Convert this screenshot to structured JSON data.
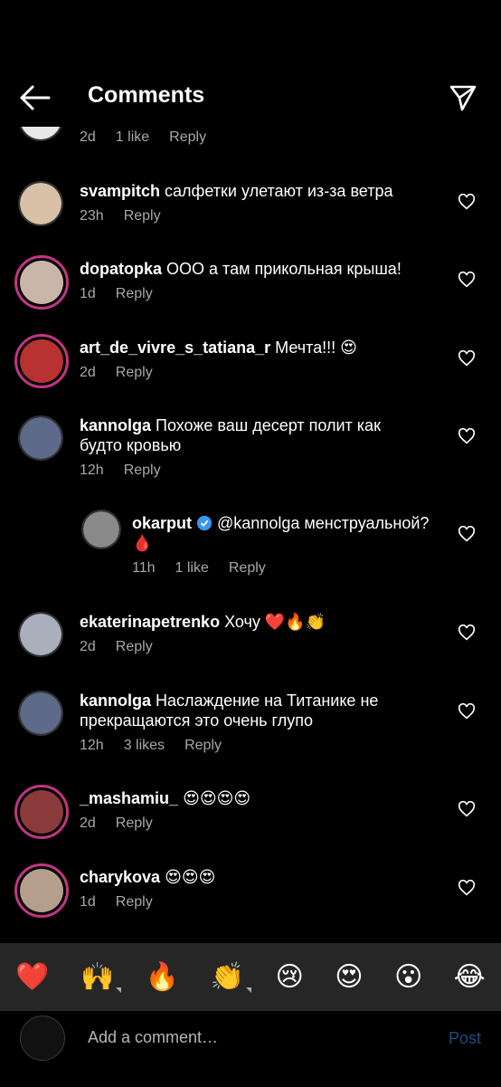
{
  "header": {
    "title": "Comments",
    "back_icon": "back-arrow-icon",
    "send_icon": "send-icon"
  },
  "comments": [
    {
      "user": "",
      "text": "",
      "time": "2d",
      "likes": "1 like",
      "reply": "Reply",
      "avatar_color": "#e8e8e8",
      "story": false
    },
    {
      "user": "svampitch",
      "text": "салфетки улетают из-за ветра",
      "time": "23h",
      "likes": "",
      "reply": "Reply",
      "avatar_color": "#d8c1a6",
      "story": false
    },
    {
      "user": "dopatopka",
      "text": "ООО а там прикольная крыша!",
      "time": "1d",
      "likes": "",
      "reply": "Reply",
      "avatar_color": "#c9b6a8",
      "story": true
    },
    {
      "user": "art_de_vivre_s_tatiana_r",
      "text": "Мечта!!! 😍",
      "time": "2d",
      "likes": "",
      "reply": "Reply",
      "avatar_color": "#b83232",
      "story": true
    },
    {
      "user": "kannolga",
      "text": "Похоже ваш десерт полит как будто кровью",
      "time": "12h",
      "likes": "",
      "reply": "Reply",
      "avatar_color": "#5d6a8a",
      "story": false
    },
    {
      "user": "okarput",
      "text": "@kannolga менструальной? 🩸",
      "time": "11h",
      "likes": "1 like",
      "reply": "Reply",
      "avatar_color": "#8a8a8a",
      "story": false,
      "verified": true
    },
    {
      "user": "ekaterinapetrenko",
      "text": "Хочу ❤️🔥👏",
      "time": "2d",
      "likes": "",
      "reply": "Reply",
      "avatar_color": "#a9b0bb",
      "story": false
    },
    {
      "user": "kannolga",
      "text": "Наслаждение на Титанике не прекращаются это очень глупо",
      "time": "12h",
      "likes": "3 likes",
      "reply": "Reply",
      "avatar_color": "#5d6a8a",
      "story": false
    },
    {
      "user": "_mashamiu_",
      "text": "😍😍😍😍",
      "time": "2d",
      "likes": "",
      "reply": "Reply",
      "avatar_color": "#8a3a3a",
      "story": true
    },
    {
      "user": "charykova",
      "text": "😍😍😍",
      "time": "1d",
      "likes": "",
      "reply": "Reply",
      "avatar_color": "#b59f8c",
      "story": true
    }
  ],
  "reactions": [
    "❤️",
    "🙌",
    "🔥",
    "👏",
    "😢",
    "😍",
    "😮",
    "😂"
  ],
  "composer": {
    "placeholder": "Add a comment…",
    "post": "Post"
  },
  "colors": {
    "background": "#000000",
    "meta": "#a8a8a8",
    "post_disabled": "#1c4f7a",
    "reaction_bar": "#262626",
    "verified": "#3897f0"
  }
}
